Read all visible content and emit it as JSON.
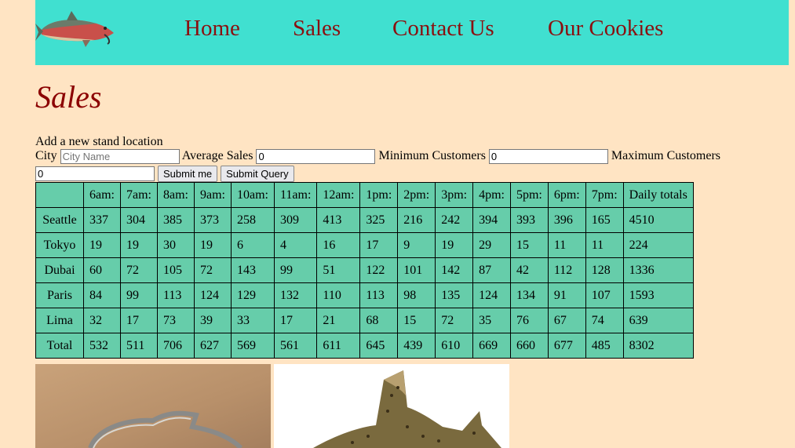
{
  "nav": {
    "items": [
      "Home",
      "Sales",
      "Contact Us",
      "Our Cookies"
    ]
  },
  "page": {
    "title": "Sales"
  },
  "form": {
    "heading": "Add a new stand location",
    "city_label": "City",
    "city_placeholder": "City Name",
    "avg_label": "Average Sales",
    "avg_value": "0",
    "min_label": "Minimum Customers",
    "min_value": "0",
    "max_label": "Maximum Customers",
    "max_value": "0",
    "submit_me": "Submit me",
    "submit_query": "Submit Query"
  },
  "table": {
    "headers": [
      "",
      "6am:",
      "7am:",
      "8am:",
      "9am:",
      "10am:",
      "11am:",
      "12am:",
      "1pm:",
      "2pm:",
      "3pm:",
      "4pm:",
      "5pm:",
      "6pm:",
      "7pm:",
      "Daily totals"
    ],
    "rows": [
      [
        "Seattle",
        "337",
        "304",
        "385",
        "373",
        "258",
        "309",
        "413",
        "325",
        "216",
        "242",
        "394",
        "393",
        "396",
        "165",
        "4510"
      ],
      [
        "Tokyo",
        "19",
        "19",
        "30",
        "19",
        "6",
        "4",
        "16",
        "17",
        "9",
        "19",
        "29",
        "15",
        "11",
        "11",
        "224"
      ],
      [
        "Dubai",
        "60",
        "72",
        "105",
        "72",
        "143",
        "99",
        "51",
        "122",
        "101",
        "142",
        "87",
        "42",
        "112",
        "128",
        "1336"
      ],
      [
        "Paris",
        "84",
        "99",
        "113",
        "124",
        "129",
        "132",
        "110",
        "113",
        "98",
        "135",
        "124",
        "134",
        "91",
        "107",
        "1593"
      ],
      [
        "Lima",
        "32",
        "17",
        "73",
        "39",
        "33",
        "17",
        "21",
        "68",
        "15",
        "72",
        "35",
        "76",
        "67",
        "74",
        "639"
      ],
      [
        "Total",
        "532",
        "511",
        "706",
        "627",
        "569",
        "561",
        "611",
        "645",
        "439",
        "610",
        "669",
        "660",
        "677",
        "485",
        "8302"
      ]
    ]
  }
}
